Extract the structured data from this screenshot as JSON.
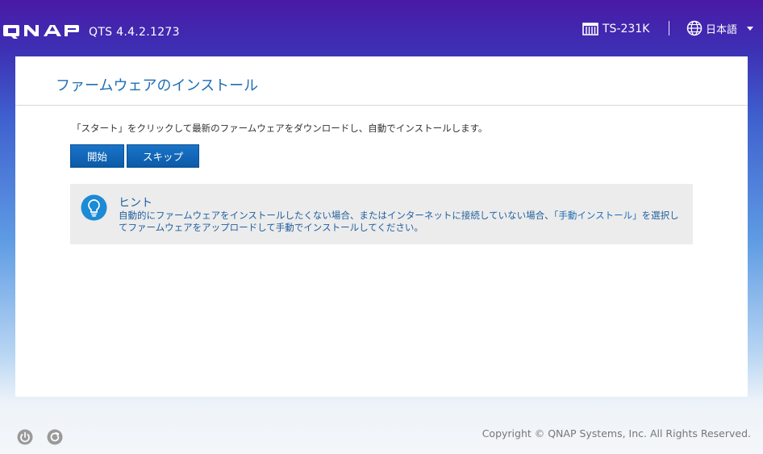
{
  "header": {
    "logo_text": "QNAP",
    "version": "QTS 4.4.2.1273",
    "device_icon": "nas-device-icon",
    "device_name": "TS-231K",
    "language_icon": "globe-icon",
    "language": "日本語"
  },
  "panel": {
    "title": "ファームウェアのインストール",
    "description": "「スタート」をクリックして最新のファームウェアをダウンロードし、自動でインストールします。",
    "start_button": "開始",
    "skip_button": "スキップ"
  },
  "hint": {
    "icon": "lightbulb-icon",
    "title": "ヒント",
    "text_before": "自動的にファームウェアをインストールしたくない場合、またはインターネットに接続していない場合、",
    "link": "「手動インストール」",
    "text_after": "を選択してファームウェアをアップロードして手動でインストールしてください。"
  },
  "footer": {
    "power_icon": "power-icon",
    "refresh_icon": "refresh-icon",
    "copyright": "Copyright © QNAP Systems, Inc. All Rights Reserved."
  },
  "colors": {
    "accent": "#1f6eb5",
    "button": "#0c5ba8",
    "hint_bg": "#ececec"
  }
}
